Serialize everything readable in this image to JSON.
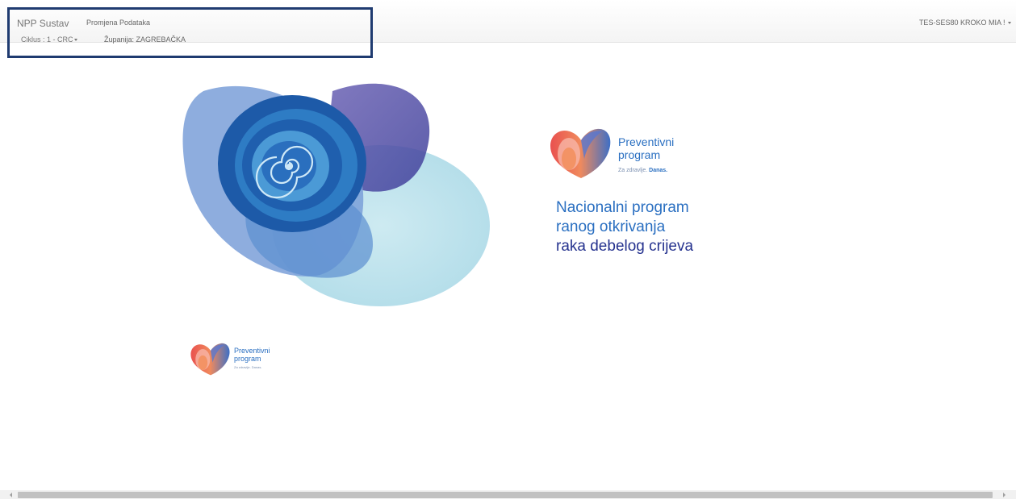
{
  "navbar": {
    "brand": "NPP Sustav",
    "nav_link": "Promjena Podataka",
    "ciklus_label": "Ciklus : 1 - CRC",
    "zupanija_label": "Županija: ZAGREBAČKA",
    "user_menu": "TES-SES80 KROKO MIA !"
  },
  "logo_big": {
    "line1": "Preventivni",
    "line2": "program",
    "tagline_prefix": "Za zdravlje.",
    "tagline_bold": "Danas."
  },
  "headline": {
    "line1": "Nacionalni program",
    "line2": "ranog otkrivanja",
    "line3": "raka debelog crijeva"
  },
  "logo_small": {
    "line1": "Preventivni",
    "line2": "program",
    "tagline": "Za zdravlje. Danas."
  },
  "colors": {
    "highlight_border": "#1f3b70",
    "primary_blue": "#2a6fc1",
    "dark_blue": "#26338f"
  },
  "icons": {
    "user_menu_caret": "caret-down-icon",
    "ciklus_caret": "caret-down-icon"
  }
}
